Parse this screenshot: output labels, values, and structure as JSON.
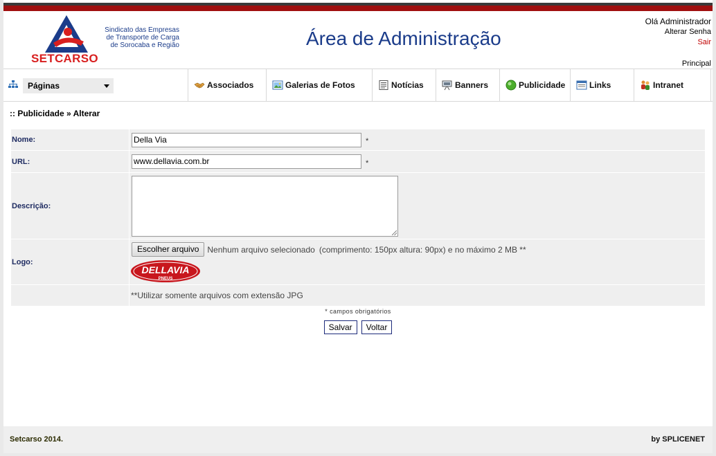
{
  "header": {
    "logo_org_lines": [
      "Sindicato das Empresas",
      "de Transporte de Carga",
      "de Sorocaba e Região"
    ],
    "logo_brand": "SETCARSO",
    "title": "Área de Administração",
    "greeting": "Olá Administrador",
    "change_password": "Alterar Senha",
    "logout": "Sair",
    "home": "Principal"
  },
  "nav": {
    "pages_select": "Páginas",
    "items": [
      {
        "label": "Associados",
        "icon": "handshake-icon"
      },
      {
        "label": "Galerias de Fotos",
        "icon": "photo-gallery-icon"
      },
      {
        "label": "Notícias",
        "icon": "news-icon"
      },
      {
        "label": "Banners",
        "icon": "banner-projector-icon"
      },
      {
        "label": "Publicidade",
        "icon": "green-globe-icon"
      },
      {
        "label": "Links",
        "icon": "links-window-icon"
      },
      {
        "label": "Intranet",
        "icon": "users-group-icon"
      }
    ]
  },
  "breadcrumb": ":: Publicidade » Alterar",
  "form": {
    "name_label": "Nome:",
    "name_value": "Della Via",
    "url_label": "URL:",
    "url_value": "www.dellavia.com.br",
    "description_label": "Descrição:",
    "description_value": "",
    "logo_label": "Logo:",
    "file_button": "Escolher arquivo",
    "file_status": "Nenhum arquivo selecionado",
    "file_hint": "(comprimento: 150px altura: 90px) e no máximo 2 MB **",
    "logo_brand": "DELLAVIA",
    "logo_sub": "PNEUS",
    "jpg_note": "**Utilizar somente arquivos com extensão JPG",
    "required_marker": "*"
  },
  "required_note": "* campos obrigatórios",
  "actions": {
    "save": "Salvar",
    "back": "Voltar"
  },
  "footer": {
    "copyright": "Setcarso 2014.",
    "credit": "by SPLICENET"
  },
  "colors": {
    "brand_red": "#a01010",
    "title_blue": "#1b3c8a",
    "label_navy": "#1e2b61"
  }
}
